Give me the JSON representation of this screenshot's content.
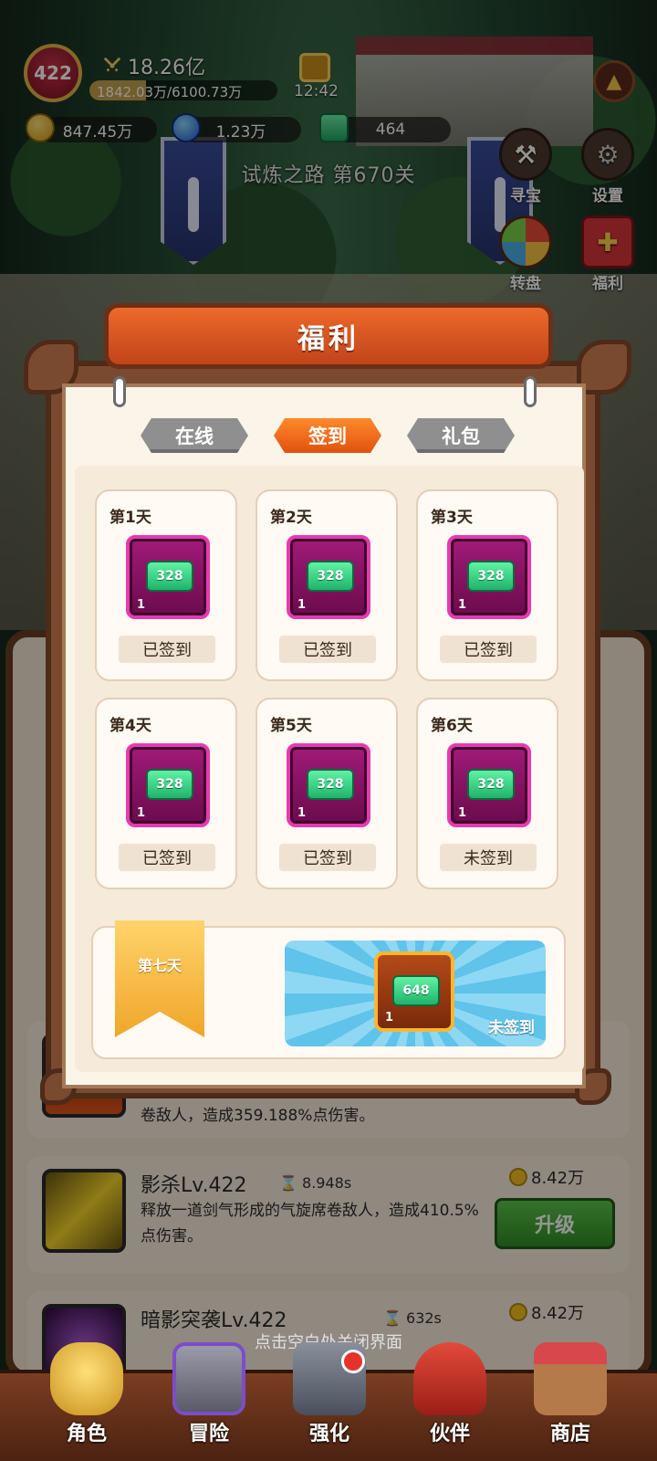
{
  "hud": {
    "level": "422",
    "power": "18.26亿",
    "exp_text": "1842.03万/6100.73万",
    "exp_progress": 0.302,
    "time": "12:42",
    "resources": [
      {
        "icon": "gold-coin-icon",
        "value": "847.45万"
      },
      {
        "icon": "blue-gem-icon",
        "value": "1.23万"
      },
      {
        "icon": "cash-icon",
        "value": "464"
      }
    ],
    "stage": "试炼之路 第670关"
  },
  "side_buttons": [
    {
      "label": "寻宝",
      "icon": "hammer-icon"
    },
    {
      "label": "设置",
      "icon": "gear-icon"
    },
    {
      "label": "转盘",
      "icon": "wheel-icon"
    },
    {
      "label": "福利",
      "icon": "gift-icon"
    }
  ],
  "modal": {
    "title": "福利",
    "tabs": [
      {
        "label": "在线",
        "active": false
      },
      {
        "label": "签到",
        "active": true
      },
      {
        "label": "礼包",
        "active": false
      }
    ],
    "days": [
      {
        "label": "第1天",
        "reward": "328",
        "count": "1",
        "status": "已签到"
      },
      {
        "label": "第2天",
        "reward": "328",
        "count": "1",
        "status": "已签到"
      },
      {
        "label": "第3天",
        "reward": "328",
        "count": "1",
        "status": "已签到"
      },
      {
        "label": "第4天",
        "reward": "328",
        "count": "1",
        "status": "已签到"
      },
      {
        "label": "第5天",
        "reward": "328",
        "count": "1",
        "status": "已签到"
      },
      {
        "label": "第6天",
        "reward": "328",
        "count": "1",
        "status": "未签到"
      }
    ],
    "day7": {
      "label": "第七天",
      "reward": "648",
      "count": "1",
      "status": "未签到"
    }
  },
  "skills": [
    {
      "name": "",
      "time": "",
      "desc": "卷敌人，造成359.188%点伤害。",
      "cost": "",
      "button": ""
    },
    {
      "name": "影杀Lv.422",
      "time": "8.948s",
      "desc": "释放一道剑气形成的气旋席卷敌人，造成410.5%点伤害。",
      "cost": "8.42万",
      "button": "升级"
    },
    {
      "name": "暗影突袭Lv.422",
      "time": "632s",
      "desc": "",
      "cost": "8.42万",
      "button": ""
    }
  ],
  "close_hint": "点击空白处关闭界面",
  "nav": [
    {
      "label": "角色",
      "icon": "character-icon"
    },
    {
      "label": "冒险",
      "icon": "adventure-icon"
    },
    {
      "label": "强化",
      "icon": "anvil-icon"
    },
    {
      "label": "伙伴",
      "icon": "partner-icon"
    },
    {
      "label": "商店",
      "icon": "shop-icon"
    }
  ],
  "colors": {
    "accent_orange": "#e0520f",
    "frame_brown": "#7a4a30",
    "reward_magenta": "#a11a78",
    "cash_green": "#1fb46a",
    "upgrade_green": "#2f8e24"
  }
}
